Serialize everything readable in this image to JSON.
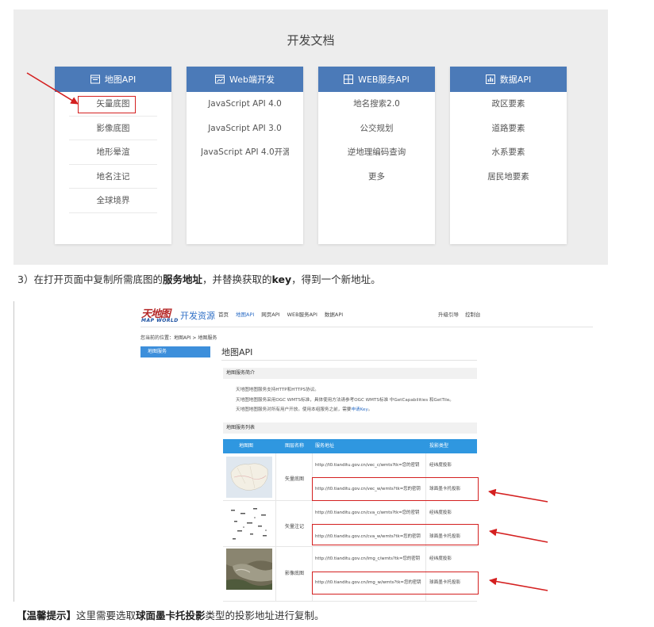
{
  "docs": {
    "title": "开发文档",
    "cards": [
      {
        "title": "地图API",
        "icon": "map-window-icon",
        "items": [
          "矢量底图",
          "影像底图",
          "地形晕渲",
          "地名注记",
          "全球境界"
        ]
      },
      {
        "title": "Web端开发",
        "icon": "browser-icon",
        "items": [
          "JavaScript API 4.0",
          "JavaScript API 3.0",
          "JavaScript API 4.0开源库"
        ]
      },
      {
        "title": "WEB服务API",
        "icon": "grid-icon",
        "items": [
          "地名搜索2.0",
          "公交规划",
          "逆地理编码查询",
          "更多"
        ]
      },
      {
        "title": "数据API",
        "icon": "bar-chart-icon",
        "items": [
          "政区要素",
          "道路要素",
          "水系要素",
          "居民地要素"
        ]
      }
    ]
  },
  "step3": {
    "prefix": "3）在打开页面中复制所需底图的",
    "bold1": "服务地址",
    "middle": "，并替换获取的",
    "bold2": "key",
    "suffix": "，得到一个新地址。"
  },
  "site": {
    "logo_cn": "天地图",
    "logo_en": "MAP WORLD",
    "title": "开发资源",
    "nav": [
      "首页",
      "地图API",
      "网页API",
      "WEB服务API",
      "数据API"
    ],
    "nav_right": [
      "升级引导",
      "控制台"
    ],
    "breadcrumb": "您当前的位置：地图API > 地图服务",
    "side_tab": "地图服务",
    "main_title": "地图API",
    "section1": "地图服务简介",
    "intro": [
      "天地图地图服务支持HTTP和HTTPS协议。",
      "天地图地图服务采用OGC WMTS标准，具体使用方法请参考OGC WMTS标准 中GetCapabilities 和GetTile。",
      "天地图地图服务对所有用户开放。使用本组服务之前，需要"
    ],
    "intro_link": "申请Key",
    "intro_end": "。",
    "section2": "地图服务列表",
    "table_headers": [
      "地图图",
      "图层名称",
      "服务地址",
      "投影类型"
    ],
    "rows": [
      {
        "name": "矢量底图",
        "urls": [
          "http://t0.tianditu.gov.cn/vec_c/wmts?tk=您的密钥",
          "http://t0.tianditu.gov.cn/vec_w/wmts?tk=您的密钥"
        ],
        "proj": [
          "经纬度投影",
          "球面墨卡托投影"
        ]
      },
      {
        "name": "矢量注记",
        "urls": [
          "http://t0.tianditu.gov.cn/cva_c/wmts?tk=您的密钥",
          "http://t0.tianditu.gov.cn/cva_w/wmts?tk=您的密钥"
        ],
        "proj": [
          "经纬度投影",
          "球面墨卡托投影"
        ]
      },
      {
        "name": "影像底图",
        "urls": [
          "http://t0.tianditu.gov.cn/img_c/wmts?tk=您的密钥",
          "http://t0.tianditu.gov.cn/img_w/wmts?tk=您的密钥"
        ],
        "proj": [
          "经纬度投影",
          "球面墨卡托投影"
        ]
      }
    ]
  },
  "tip": {
    "label": "【温馨提示】",
    "prefix": "这里需要选取",
    "bold": "球面墨卡托投影",
    "suffix": "类型的投影地址进行复制。"
  },
  "colors": {
    "header_blue": "#4b7ab8",
    "table_blue": "#2f97e0",
    "annotation_red": "#d42020"
  }
}
